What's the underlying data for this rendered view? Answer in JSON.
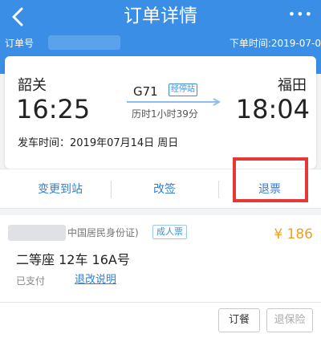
{
  "header": {
    "title": "订单详情",
    "more": "•••",
    "order_no_label": "订单号",
    "order_time": "下单时间:2019-07-0"
  },
  "trip": {
    "from_station": "韶关",
    "to_station": "福田",
    "departure_time": "16:25",
    "arrival_time": "18:04",
    "train_number": "G71",
    "stops_label": "经停站",
    "duration": "历时1小时39分",
    "departure_date": "发车时间：2019年07月14日 周日"
  },
  "actions": {
    "change_station": "变更到站",
    "reschedule": "改签",
    "refund": "退票"
  },
  "passenger": {
    "id_type": "中国居民身份证)",
    "ticket_type": "成人票",
    "price": "¥ 186",
    "seat": "二等座 12车 16A号",
    "pay_status": "已支付",
    "refund_rules": "退改说明"
  },
  "bottom": {
    "order_meal": "订餐",
    "refund_insurance": "退保险"
  },
  "colors": {
    "header_bg": "#3a8ee6",
    "link": "#2e7fd8",
    "price": "#f0a020",
    "highlight": "#e53935"
  }
}
